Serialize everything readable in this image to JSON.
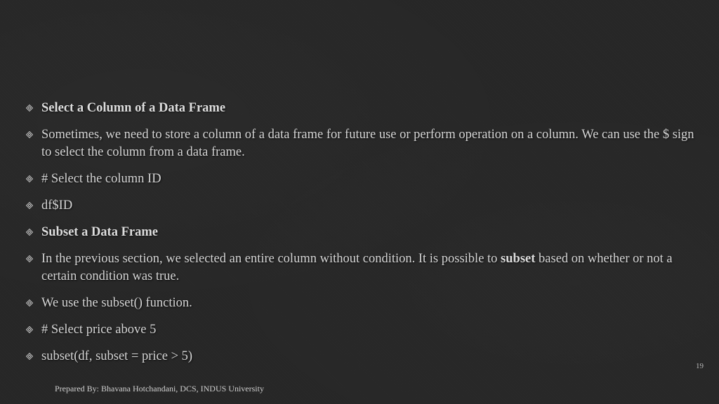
{
  "bullets": [
    {
      "html": "<strong>Select a Column of a Data Frame</strong>"
    },
    {
      "html": "Sometimes, we need to store a column of a data frame for future use or perform operation on a column. We can use the $ sign to select the column from a data frame."
    },
    {
      "html": "# Select the column ID"
    },
    {
      "html": "df$ID"
    },
    {
      "html": "<strong>Subset a Data Frame</strong>"
    },
    {
      "html": "In the previous section, we selected an entire column without condition. It is possible to <strong>subset</strong> based on whether or not a certain condition was true."
    },
    {
      "html": "We use the subset() function."
    },
    {
      "html": "# Select price above 5"
    },
    {
      "html": "subset(df, subset = price > 5)"
    }
  ],
  "page_number": "19",
  "footer": "Prepared By: Bhavana Hotchandani, DCS, INDUS University"
}
